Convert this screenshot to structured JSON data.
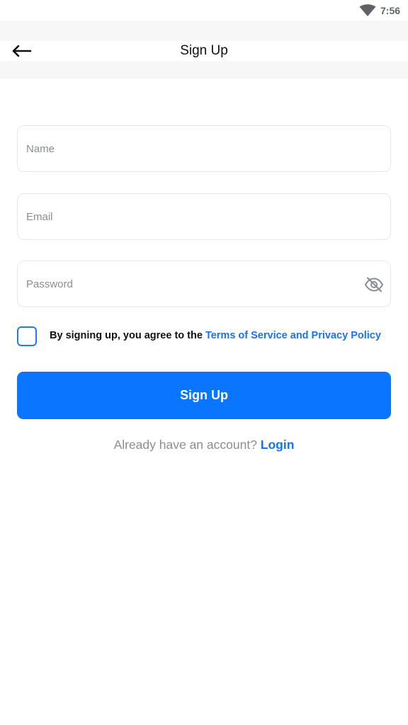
{
  "status_bar": {
    "time": "7:56",
    "wifi_icon": "wifi-icon"
  },
  "header": {
    "title": "Sign Up",
    "back_icon": "arrow-left-icon"
  },
  "form": {
    "name": {
      "placeholder": "Name",
      "value": ""
    },
    "email": {
      "placeholder": "Email",
      "value": ""
    },
    "password": {
      "placeholder": "Password",
      "value": "",
      "visibility_icon": "eye-off-icon"
    },
    "agree": {
      "checked": false,
      "text": "By signing up, you agree to the ",
      "link": "Terms of Service and Privacy Policy"
    },
    "submit_label": "Sign Up"
  },
  "footer": {
    "prompt": "Already have an account? ",
    "login_label": "Login"
  },
  "colors": {
    "accent": "#0a76ff",
    "link": "#1a73e8",
    "muted": "#8a8d94",
    "border": "#e6e7ea"
  }
}
